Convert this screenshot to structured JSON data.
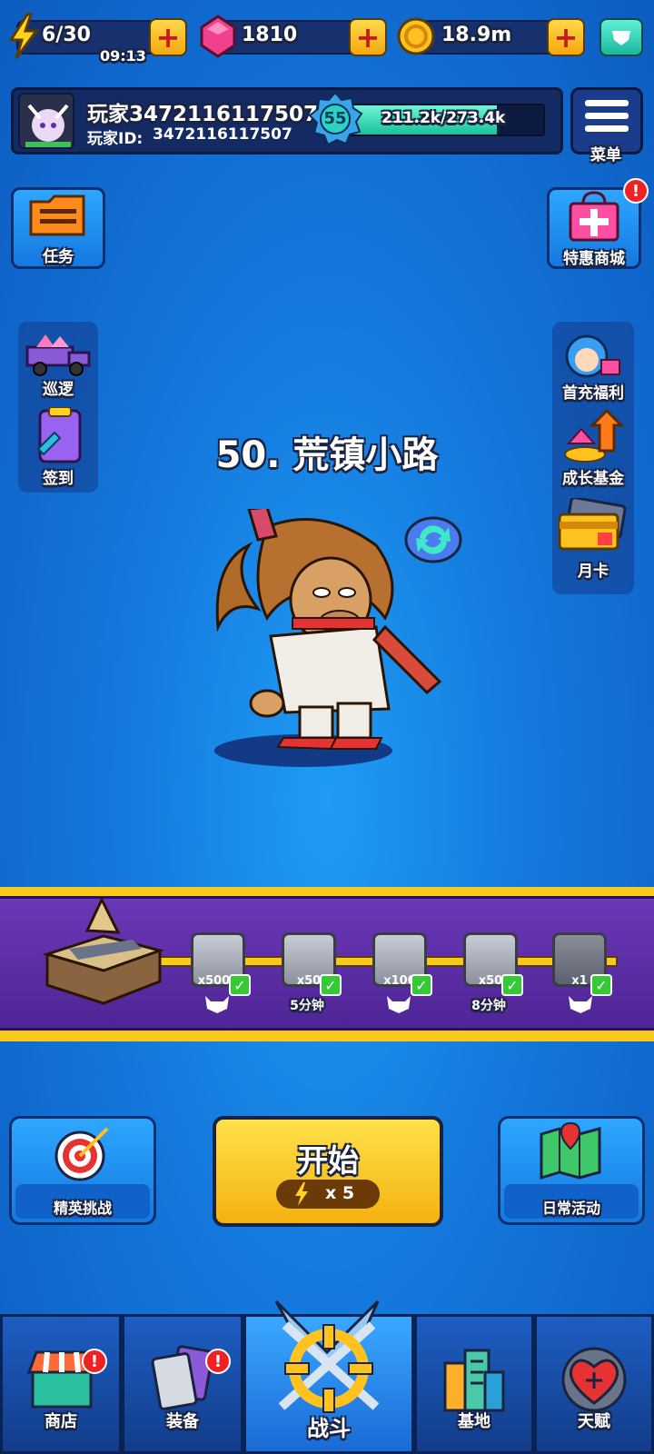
{
  "resources": {
    "energy": "6/30",
    "energy_timer": "09:13",
    "gems": "1810",
    "coins": "18.9m"
  },
  "player": {
    "name": "玩家3472116117507",
    "id_label": "玩家ID:",
    "id_value": "3472116117507",
    "level": "55",
    "xp": "211.2k/273.4k",
    "xp_fraction": 0.77
  },
  "menu_label": "菜单",
  "left_buttons": {
    "tasks": "任务",
    "patrol": "巡逻",
    "signin": "签到"
  },
  "right_buttons": {
    "shop_special": "特惠商城",
    "first_recharge": "首充福利",
    "growth_fund": "成长基金",
    "monthly_card": "月卡"
  },
  "stage_title": "50. 荒镇小路",
  "rewards": [
    {
      "qty": "x5000",
      "label": ""
    },
    {
      "qty": "x50",
      "label": "5分钟"
    },
    {
      "qty": "x100",
      "label": ""
    },
    {
      "qty": "x50",
      "label": "8分钟"
    },
    {
      "qty": "x1",
      "label": ""
    }
  ],
  "buttons": {
    "elite": "精英挑战",
    "start": "开始",
    "start_cost": "x 5",
    "daily": "日常活动"
  },
  "nav": {
    "shop": "商店",
    "equip": "装备",
    "battle": "战斗",
    "base": "基地",
    "talent": "天赋"
  },
  "colors": {
    "accent_yellow": "#f9c91d",
    "banner_purple": "#5b2fa6",
    "xp_green": "#2de0b4"
  }
}
